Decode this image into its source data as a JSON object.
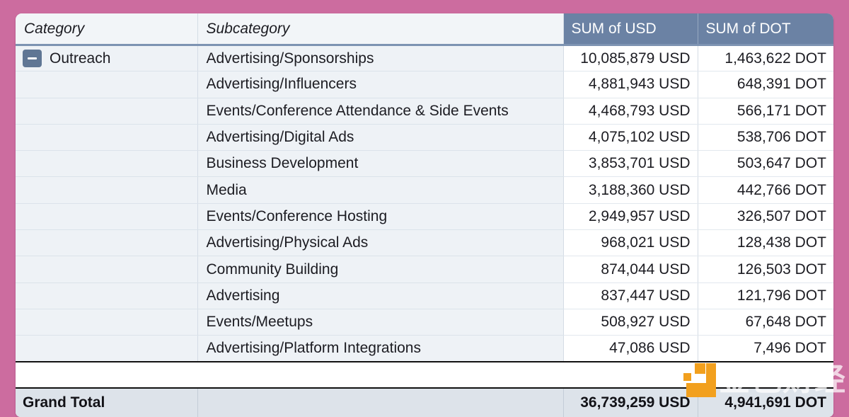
{
  "theme": {
    "page_background": "#cc6c9f",
    "header_accent": "#6b82a4",
    "row_tint": "#eef2f6",
    "grand_total_background": "#dde3ea",
    "watermark_orange": "#f2a01e"
  },
  "table": {
    "columns": [
      {
        "key": "category",
        "label": "Category"
      },
      {
        "key": "subcategory",
        "label": "Subcategory"
      },
      {
        "key": "sum_usd",
        "label": "SUM of USD"
      },
      {
        "key": "sum_dot",
        "label": "SUM of DOT"
      }
    ],
    "group": {
      "name": "Outreach",
      "collapse_icon": "minus-icon",
      "expanded": true
    },
    "rows": [
      {
        "category": "Outreach",
        "subcategory": "Advertising/Sponsorships",
        "sum_usd": "10,085,879 USD",
        "sum_dot": "1,463,622 DOT"
      },
      {
        "category": "",
        "subcategory": "Advertising/Influencers",
        "sum_usd": "4,881,943 USD",
        "sum_dot": "648,391 DOT"
      },
      {
        "category": "",
        "subcategory": "Events/Conference Attendance & Side Events",
        "sum_usd": "4,468,793 USD",
        "sum_dot": "566,171 DOT"
      },
      {
        "category": "",
        "subcategory": "Advertising/Digital Ads",
        "sum_usd": "4,075,102 USD",
        "sum_dot": "538,706 DOT"
      },
      {
        "category": "",
        "subcategory": "Business Development",
        "sum_usd": "3,853,701 USD",
        "sum_dot": "503,647 DOT"
      },
      {
        "category": "",
        "subcategory": "Media",
        "sum_usd": "3,188,360 USD",
        "sum_dot": "442,766 DOT"
      },
      {
        "category": "",
        "subcategory": "Events/Conference Hosting",
        "sum_usd": "2,949,957 USD",
        "sum_dot": "326,507 DOT"
      },
      {
        "category": "",
        "subcategory": "Advertising/Physical Ads",
        "sum_usd": "968,021 USD",
        "sum_dot": "128,438 DOT"
      },
      {
        "category": "",
        "subcategory": "Community Building",
        "sum_usd": "874,044 USD",
        "sum_dot": "126,503 DOT"
      },
      {
        "category": "",
        "subcategory": "Advertising",
        "sum_usd": "837,447 USD",
        "sum_dot": "121,796 DOT"
      },
      {
        "category": "",
        "subcategory": "Events/Meetups",
        "sum_usd": "508,927 USD",
        "sum_dot": "67,648 DOT"
      },
      {
        "category": "",
        "subcategory": "Advertising/Platform Integrations",
        "sum_usd": "47,086 USD",
        "sum_dot": "7,496 DOT"
      }
    ],
    "grand_total": {
      "label": "Grand Total",
      "subcategory": "",
      "sum_usd": "36,739,259 USD",
      "sum_dot": "4,941,691 DOT"
    }
  },
  "watermark": {
    "text": "金色财经",
    "logo_name": "jinse-finance-logo"
  }
}
